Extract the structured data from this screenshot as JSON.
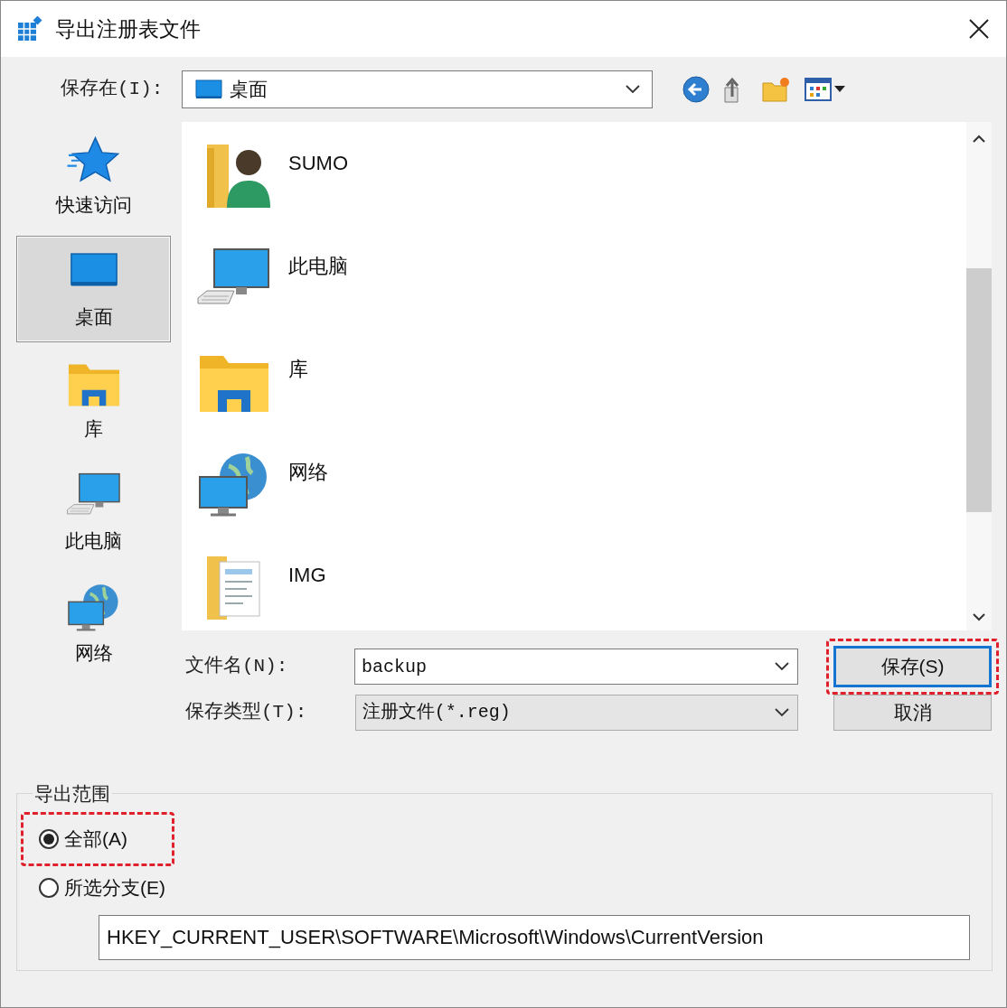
{
  "window": {
    "title": "导出注册表文件"
  },
  "save_in": {
    "label": "保存在(I):",
    "value": "桌面"
  },
  "sidebar": {
    "items": [
      {
        "label": "快速访问",
        "kind": "star",
        "selected": false
      },
      {
        "label": "桌面",
        "kind": "desktop",
        "selected": true
      },
      {
        "label": "库",
        "kind": "library",
        "selected": false
      },
      {
        "label": "此电脑",
        "kind": "computer",
        "selected": false
      },
      {
        "label": "网络",
        "kind": "network",
        "selected": false
      }
    ]
  },
  "files": {
    "items": [
      {
        "name": "SUMO",
        "kind": "user"
      },
      {
        "name": "此电脑",
        "kind": "computer"
      },
      {
        "name": "库",
        "kind": "library"
      },
      {
        "name": "网络",
        "kind": "network"
      },
      {
        "name": "IMG",
        "kind": "documents"
      }
    ]
  },
  "file_name": {
    "label": "文件名(N):",
    "value": "backup"
  },
  "file_type": {
    "label": "保存类型(T):",
    "value": "注册文件(*.reg)"
  },
  "buttons": [
    {
      "label": "保存(S)",
      "default": true,
      "highlighted": true
    },
    {
      "label": "取消",
      "default": false,
      "highlighted": false
    }
  ],
  "export_range": {
    "title": "导出范围",
    "options": [
      {
        "label": "全部(A)",
        "selected": true,
        "highlighted": true
      },
      {
        "label": "所选分支(E)",
        "selected": false,
        "highlighted": false
      }
    ],
    "branch": "HKEY_CURRENT_USER\\SOFTWARE\\Microsoft\\Windows\\CurrentVersion"
  }
}
